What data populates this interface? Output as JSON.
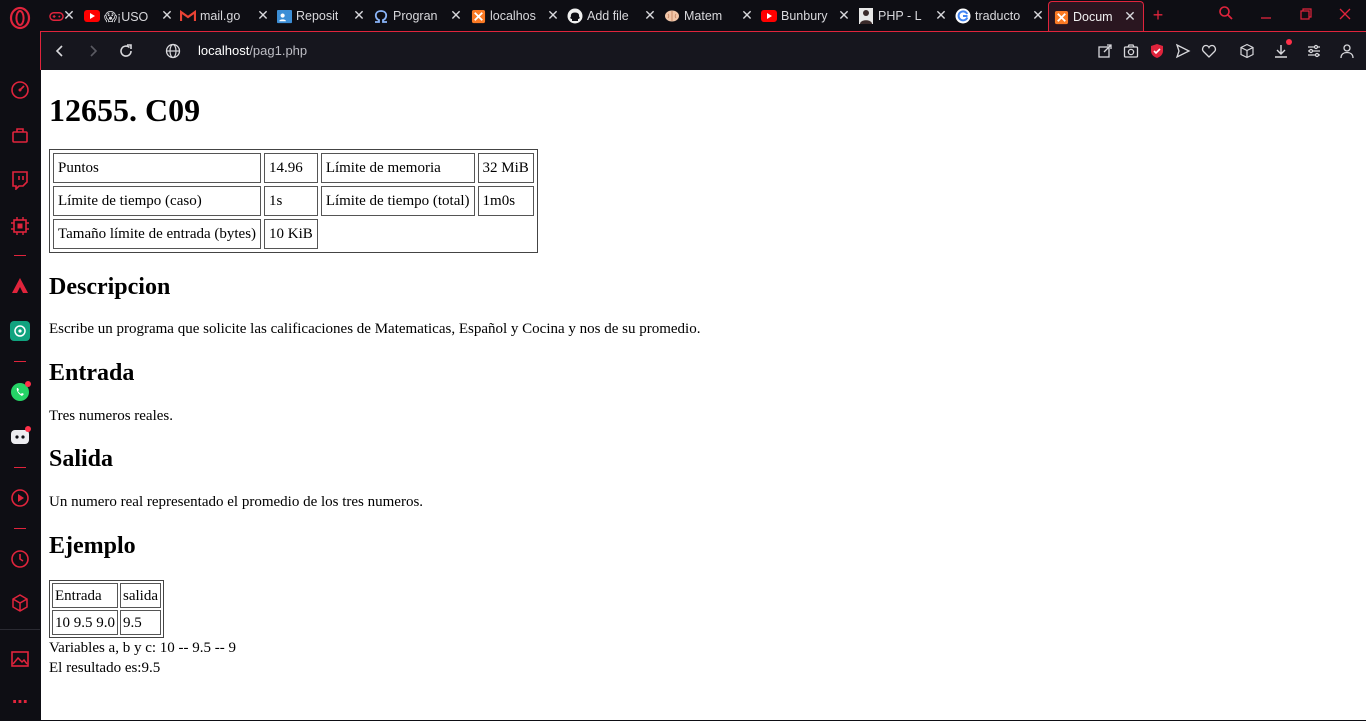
{
  "browser": {
    "tabs": [
      {
        "label": "",
        "icon": "gamepad-icon"
      },
      {
        "label": "😱¡USO",
        "icon": "youtube-icon"
      },
      {
        "label": "mail.go",
        "icon": "gmail-icon"
      },
      {
        "label": "Reposit",
        "icon": "contact-card-icon"
      },
      {
        "label": "Progran",
        "icon": "omega-icon"
      },
      {
        "label": "localhos",
        "icon": "xampp-icon"
      },
      {
        "label": "Add file",
        "icon": "github-icon"
      },
      {
        "label": "Matem",
        "icon": "brain-icon"
      },
      {
        "label": "Bunbury",
        "icon": "youtube-icon"
      },
      {
        "label": "PHP - L",
        "icon": "person-photo-icon"
      },
      {
        "label": "traducto",
        "icon": "google-icon"
      }
    ],
    "active_tab": {
      "label": "Docum",
      "icon": "xampp-icon"
    },
    "url": {
      "host": "localhost",
      "path": "/pag1.php"
    },
    "accent_color": "#e0243c"
  },
  "page": {
    "title": "12655. C09",
    "info_table": [
      [
        {
          "text": "Puntos"
        },
        {
          "text": "14.96"
        },
        {
          "text": "Límite de memoria"
        },
        {
          "text": "32 MiB"
        }
      ],
      [
        {
          "text": "Límite de tiempo (caso)"
        },
        {
          "text": "1s"
        },
        {
          "text": "Límite de tiempo (total)"
        },
        {
          "text": "1m0s"
        }
      ],
      [
        {
          "text": "Tamaño límite de entrada (bytes)"
        },
        {
          "text": "10 KiB"
        }
      ]
    ],
    "descripcion": {
      "heading": "Descripcion",
      "text": "Escribe un programa que solicite las calificaciones de Matematicas, Español y Cocina y nos de su promedio."
    },
    "entrada": {
      "heading": "Entrada",
      "text": "Tres numeros reales."
    },
    "salida": {
      "heading": "Salida",
      "text": "Un numero real representado el promedio de los tres numeros."
    },
    "ejemplo": {
      "heading": "Ejemplo",
      "headers": [
        "Entrada",
        "salida"
      ],
      "row": [
        "10 9.5 9.0",
        "9.5"
      ]
    },
    "output_lines": [
      "Variables a, b y c: 10 -- 9.5 -- 9",
      "El resultado es:9.5"
    ]
  }
}
